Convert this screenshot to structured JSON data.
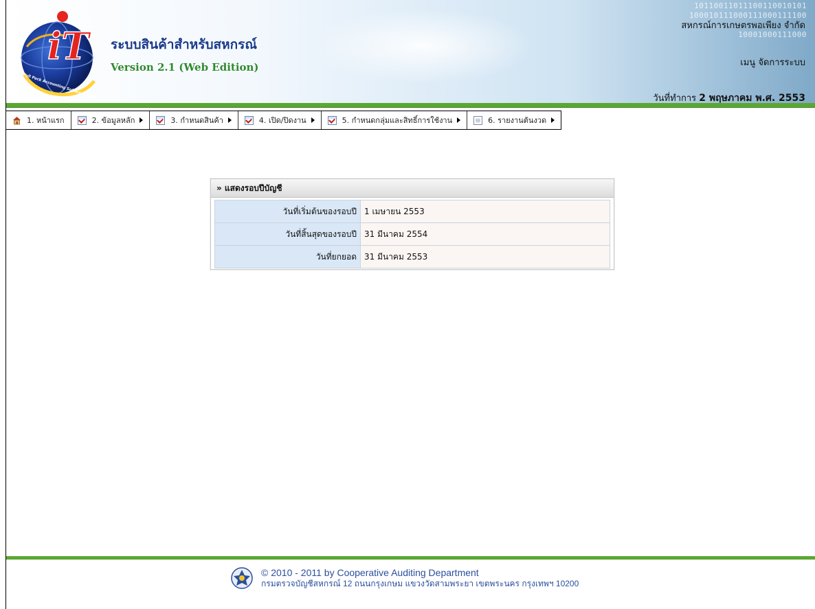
{
  "header": {
    "app_title": "ระบบสินค้าสำหรับสหกรณ์",
    "app_version": "Version 2.1 (Web Edition)",
    "organization": "สหกรณ์การเกษตรพอเพียง จำกัด",
    "menu_user": "เมนู จัดการระบบ",
    "work_date_label": "วันที่ทำการ",
    "work_date_value": "2 พฤษภาคม พ.ศ. 2553",
    "logo_text": "iT",
    "logo_arc_text": "Full Pack Accounting Software : FAS",
    "binary_pattern": "10110011011100110010101\n100010111000111000111100\n\n10001000111000"
  },
  "menu": [
    {
      "label": "1. หน้าแรก",
      "icon": "home-icon",
      "has_submenu": false
    },
    {
      "label": "2. ข้อมูลหลัก",
      "icon": "checkbox-icon",
      "has_submenu": true
    },
    {
      "label": "3. กำหนดสินค้า",
      "icon": "checkbox-icon",
      "has_submenu": true
    },
    {
      "label": "4. เปิด/ปิดงาน",
      "icon": "checkbox-icon",
      "has_submenu": true
    },
    {
      "label": "5. กำหนดกลุ่มและสิทธิ์การใช้งาน",
      "icon": "checkbox-icon",
      "has_submenu": true
    },
    {
      "label": "6. รายงานต้นงวด",
      "icon": "document-icon",
      "has_submenu": true
    }
  ],
  "fiscal_panel": {
    "title": "» แสดงรอบปีบัญชี",
    "rows": [
      {
        "label": "วันที่เริ่มต้นของรอบปี",
        "value": "1 เมษายน 2553"
      },
      {
        "label": "วันที่สิ้นสุดของรอบปี",
        "value": "31 มีนาคม 2554"
      },
      {
        "label": "วันที่ยกยอด",
        "value": "31 มีนาคม 2553"
      }
    ]
  },
  "footer": {
    "copyright": "© 2010 - 2011  by Cooperative Auditing Department",
    "address": "กรมตรวจบัญชีสหกรณ์ 12 ถนนกรุงเกษม แขวงวัดสามพระยา เขตพระนคร กรุงเทพฯ 10200"
  },
  "colors": {
    "accent_green": "#5aa832",
    "title_blue": "#1a3a8a",
    "version_green": "#2f8a2f",
    "label_cell": "#d9e7f6",
    "value_cell": "#fbf6f3",
    "footer_text": "#2a4f9c"
  }
}
